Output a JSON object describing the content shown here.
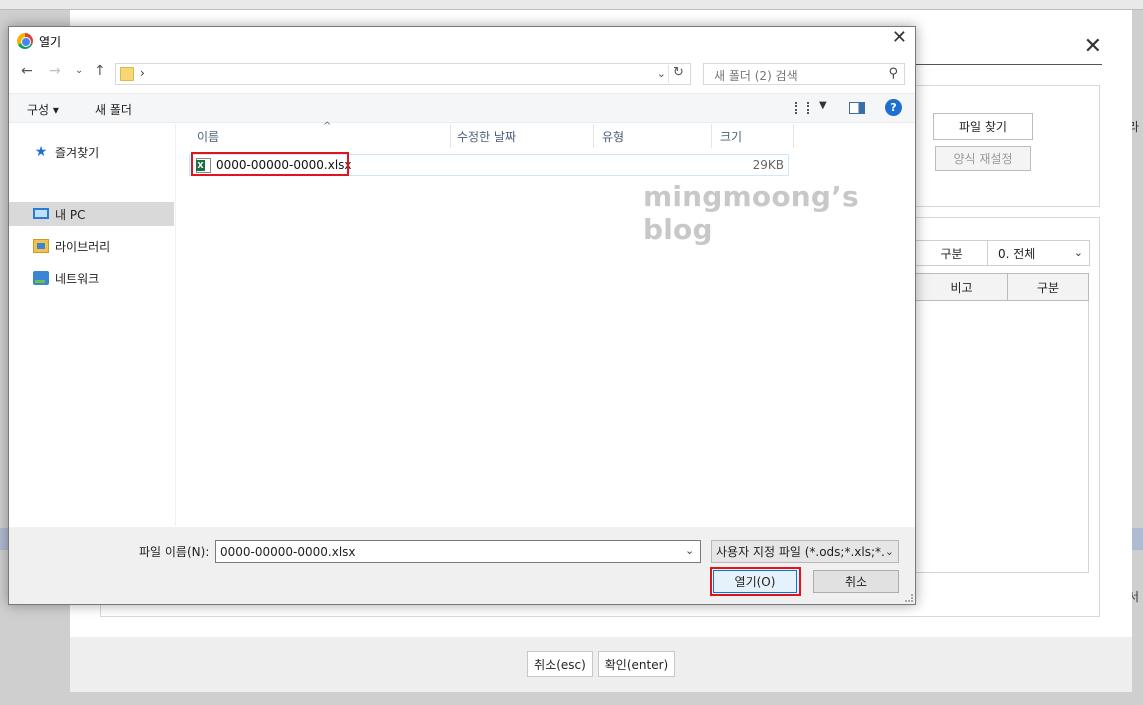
{
  "background": {
    "right_text_top": "라",
    "right_text_bottom": "서"
  },
  "web_modal": {
    "close_glyph": "✕",
    "buttons": {
      "find_file": "파일 찾기",
      "reset_form": "양식 재설정"
    },
    "filter": {
      "label": "구분",
      "value": "0. 전체"
    },
    "table_headers": [
      "비고",
      "구분"
    ],
    "footer": {
      "cancel": "취소(esc)",
      "confirm": "확인(enter)"
    }
  },
  "dialog": {
    "title": "열기",
    "close_glyph": "✕",
    "address": {
      "path_arrow": "›"
    },
    "search": {
      "placeholder": "새 폴더 (2) 검색"
    },
    "toolbar": {
      "organize": "구성 ▾",
      "new_folder": "새 폴더",
      "help": "?"
    },
    "nav_items": [
      {
        "label": "즐겨찾기",
        "icon": "star-icon"
      },
      {
        "label": "내 PC",
        "icon": "pc-icon",
        "selected": true
      },
      {
        "label": "라이브러리",
        "icon": "library-icon"
      },
      {
        "label": "네트워크",
        "icon": "network-icon"
      }
    ],
    "columns": [
      "이름",
      "수정한 날짜",
      "유형",
      "크기"
    ],
    "files": [
      {
        "name": "0000-00000-0000.xlsx",
        "size": "29KB",
        "icon": "excel-file-icon"
      }
    ],
    "watermark": "mingmoong’s blog",
    "file_name_label": "파일 이름(N):",
    "file_name_value": "0000-00000-0000.xlsx",
    "file_type": "사용자 지정 파일 (*.ods;*.xls;*.",
    "open_button": "열기(O)",
    "cancel_button": "취소"
  },
  "colors": {
    "highlight": "#e0141e",
    "accent": "#0078d7"
  }
}
